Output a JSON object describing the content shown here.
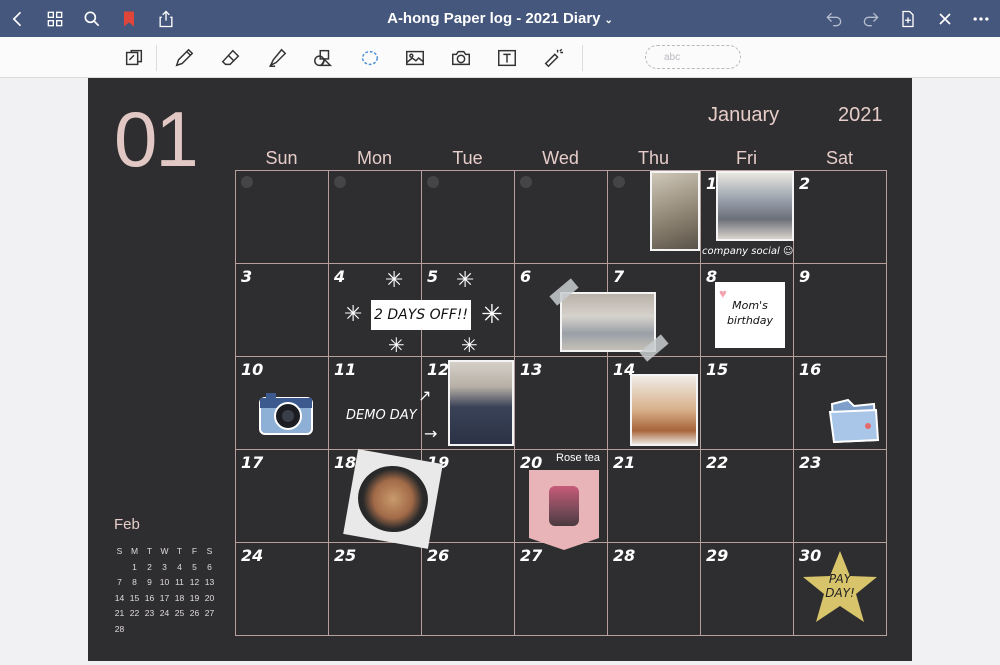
{
  "app": {
    "title": "A-hong Paper log - 2021 Diary",
    "title_chevron": "⌄"
  },
  "toolbar": {
    "text_placeholder": "abc"
  },
  "calendar": {
    "month_number": "01",
    "month_name": "January",
    "year": "2021",
    "weekdays": [
      "Sun",
      "Mon",
      "Tue",
      "Wed",
      "Thu",
      "Fri",
      "Sat"
    ],
    "days": [
      "",
      "",
      "",
      "",
      "",
      "1",
      "2",
      "3",
      "4",
      "5",
      "6",
      "7",
      "8",
      "9",
      "10",
      "11",
      "12",
      "13",
      "14",
      "15",
      "16",
      "17",
      "18",
      "19",
      "20",
      "21",
      "22",
      "23",
      "24",
      "25",
      "26",
      "27",
      "28",
      "29",
      "30"
    ]
  },
  "stickers": {
    "company_social": "company social ☺",
    "days_off": "2 DAYS OFF!!",
    "moms_birthday_line1": "Mom's",
    "moms_birthday_line2": "birthday",
    "demo_day": "DEMO DAY",
    "rose_tea": "Rose tea",
    "pay_day_line1": "PAY",
    "pay_day_line2": "DAY!"
  },
  "mini_calendar": {
    "month": "Feb",
    "weekdays": [
      "S",
      "M",
      "T",
      "W",
      "T",
      "F",
      "S"
    ],
    "days": [
      "",
      "1",
      "2",
      "3",
      "4",
      "5",
      "6",
      "7",
      "8",
      "9",
      "10",
      "11",
      "12",
      "13",
      "14",
      "15",
      "16",
      "17",
      "18",
      "19",
      "20",
      "21",
      "22",
      "23",
      "24",
      "25",
      "26",
      "27",
      "28"
    ]
  },
  "colors": {
    "titlebar": "#46577d",
    "page": "#2e2e30",
    "accent_text": "#e7cdc9",
    "bookmark": "#e0453a"
  }
}
